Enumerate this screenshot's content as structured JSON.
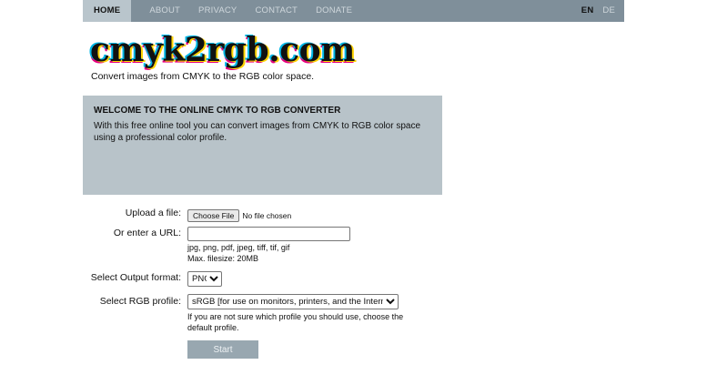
{
  "nav": {
    "items": [
      "HOME",
      "ABOUT",
      "PRIVACY",
      "CONTACT",
      "DONATE"
    ],
    "active": "HOME",
    "languages": [
      "EN",
      "DE"
    ],
    "active_language": "EN"
  },
  "header": {
    "logo": "cmyk2rgb.com",
    "tagline": "Convert images from CMYK to the RGB color space."
  },
  "welcome": {
    "title": "WELCOME TO THE ONLINE CMYK TO RGB CONVERTER",
    "text": "With this free online tool you can convert images from CMYK to RGB color space using a professional color profile."
  },
  "form": {
    "upload_label": "Upload a file:",
    "choose_file_button": "Choose File",
    "file_status": "No file chosen",
    "url_label": "Or enter a URL:",
    "url_value": "",
    "formats_hint": "jpg, png, pdf, jpeg, tiff, tif, gif",
    "filesize_hint": "Max. filesize: 20MB",
    "output_format_label": "Select Output format:",
    "output_format_value": "PNG",
    "rgb_profile_label": "Select RGB profile:",
    "rgb_profile_value": "sRGB [for use on monitors, printers, and the Internet]",
    "profile_hint": "If you are not sure which profile you should use, choose the default profile.",
    "start_button": "Start"
  },
  "colors": {
    "navbar": "#7f8f9a",
    "nav_active": "#b9c5cc",
    "welcome_bg": "#b8c3c9",
    "start_button": "#98a7b0"
  }
}
